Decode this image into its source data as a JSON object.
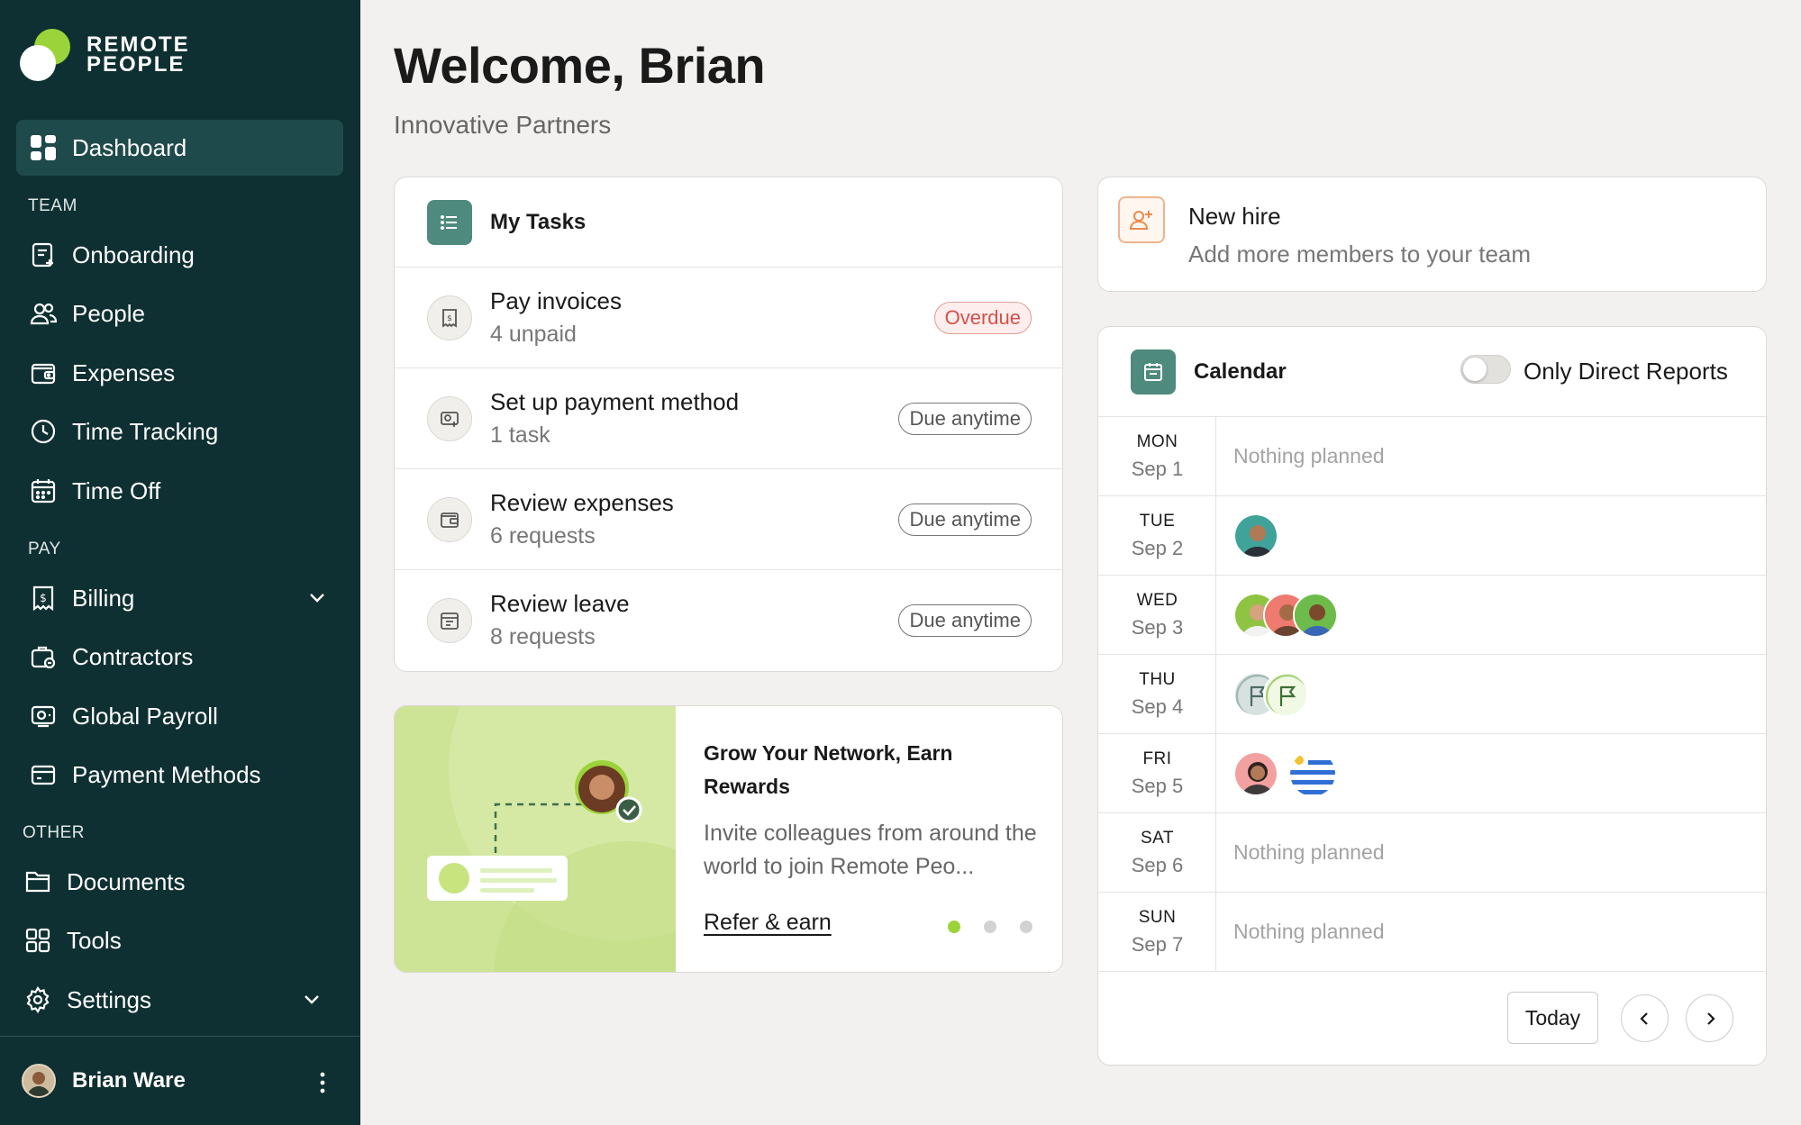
{
  "brand": {
    "line1": "REMOTE",
    "line2": "PEOPLE"
  },
  "sidebar": {
    "dashboard": "Dashboard",
    "team_label": "TEAM",
    "team": [
      "Onboarding",
      "People",
      "Expenses",
      "Time Tracking",
      "Time Off"
    ],
    "pay_label": "PAY",
    "pay": [
      "Billing",
      "Contractors",
      "Global Payroll",
      "Payment Methods"
    ],
    "other_label": "OTHER",
    "other": [
      "Documents",
      "Tools",
      "Settings"
    ],
    "user": "Brian Ware"
  },
  "header": {
    "title": "Welcome, Brian",
    "subtitle": "Innovative Partners"
  },
  "tasks": {
    "title": "My Tasks",
    "items": [
      {
        "title": "Pay invoices",
        "sub": "4 unpaid",
        "badge": "Overdue"
      },
      {
        "title": "Set up payment method",
        "sub": "1 task",
        "badge": "Due anytime"
      },
      {
        "title": "Review expenses",
        "sub": "6 requests",
        "badge": "Due anytime"
      },
      {
        "title": "Review leave",
        "sub": "8 requests",
        "badge": "Due anytime"
      }
    ]
  },
  "promo": {
    "title": "Grow Your Network, Earn Rewards",
    "text": "Invite colleagues from around the world to join Remote Peo...",
    "link": "Refer & earn"
  },
  "new_hire": {
    "title": "New hire",
    "subtitle": "Add more members to your team"
  },
  "calendar": {
    "title": "Calendar",
    "toggle_label": "Only Direct Reports",
    "days": [
      {
        "dow": "MON",
        "date": "Sep 1",
        "empty": "Nothing planned"
      },
      {
        "dow": "TUE",
        "date": "Sep 2"
      },
      {
        "dow": "WED",
        "date": "Sep 3"
      },
      {
        "dow": "THU",
        "date": "Sep 4"
      },
      {
        "dow": "FRI",
        "date": "Sep 5"
      },
      {
        "dow": "SAT",
        "date": "Sep 6",
        "empty": "Nothing planned"
      },
      {
        "dow": "SUN",
        "date": "Sep 7",
        "empty": "Nothing planned"
      }
    ],
    "today": "Today"
  },
  "colors": {
    "sidebar": "#0f3032",
    "accent_green": "#9bd33a",
    "overdue": "#d5504a"
  }
}
